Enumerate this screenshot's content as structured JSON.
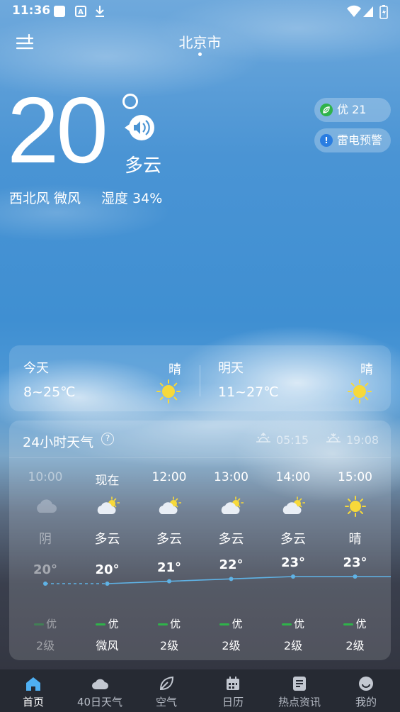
{
  "status_bar": {
    "time": "11:36"
  },
  "header": {
    "city": "北京市"
  },
  "current": {
    "temperature": "20",
    "condition": "多云",
    "wind": "西北风 微风",
    "humidity": "湿度 34%"
  },
  "badges": {
    "aqi": "优 21",
    "alert": "雷电预警"
  },
  "daily": {
    "today": {
      "label": "今天",
      "range": "8~25℃",
      "condition": "晴",
      "icon": "sun-icon"
    },
    "tomorrow": {
      "label": "明天",
      "range": "11~27℃",
      "condition": "晴",
      "icon": "sun-icon"
    }
  },
  "hourly": {
    "title": "24小时天气",
    "sunrise": "05:15",
    "sunset": "19:08",
    "hours": [
      {
        "time": "10:00",
        "condition": "阴",
        "temp": "20°",
        "aqi": "优",
        "level": "2级",
        "icon": "overcast-cloud-icon"
      },
      {
        "time": "现在",
        "condition": "多云",
        "temp": "20°",
        "aqi": "优",
        "level": "微风",
        "icon": "partly-cloudy-icon"
      },
      {
        "time": "12:00",
        "condition": "多云",
        "temp": "21°",
        "aqi": "优",
        "level": "2级",
        "icon": "partly-cloudy-icon"
      },
      {
        "time": "13:00",
        "condition": "多云",
        "temp": "22°",
        "aqi": "优",
        "level": "2级",
        "icon": "partly-cloudy-icon"
      },
      {
        "time": "14:00",
        "condition": "多云",
        "temp": "23°",
        "aqi": "优",
        "level": "2级",
        "icon": "partly-cloudy-icon"
      },
      {
        "time": "15:00",
        "condition": "晴",
        "temp": "23°",
        "aqi": "优",
        "level": "2级",
        "icon": "sun-icon"
      }
    ],
    "temps": [
      20,
      20,
      21,
      22,
      23,
      23
    ]
  },
  "tabs": [
    {
      "label": "首页",
      "icon": "home-icon",
      "active": true
    },
    {
      "label": "40日天气",
      "icon": "cloud-icon",
      "active": false
    },
    {
      "label": "空气",
      "icon": "leaf-icon",
      "active": false
    },
    {
      "label": "日历",
      "icon": "calendar-icon",
      "active": false
    },
    {
      "label": "热点资讯",
      "icon": "news-icon",
      "active": false
    },
    {
      "label": "我的",
      "icon": "profile-icon",
      "active": false
    }
  ],
  "colors": {
    "aqi_good": "#2fb34a",
    "alert_blue": "#2a7de1",
    "sun": "#f7d93a",
    "line": "#5fb3e6"
  }
}
